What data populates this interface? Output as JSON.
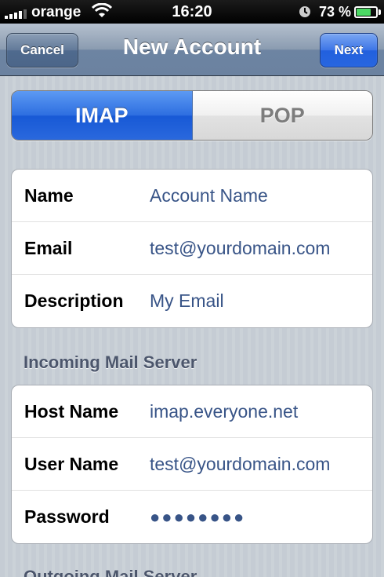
{
  "status_bar": {
    "carrier": "orange",
    "time": "16:20",
    "battery_percent": "73 %",
    "battery_level": 0.73,
    "signal_icon": "signal-bars-icon",
    "wifi_icon": "wifi-icon",
    "alarm_icon": "alarm-clock-icon",
    "battery_icon": "battery-icon"
  },
  "nav": {
    "cancel_label": "Cancel",
    "title": "New Account",
    "next_label": "Next"
  },
  "segmented": {
    "options": [
      "IMAP",
      "POP"
    ],
    "selected": "IMAP"
  },
  "account": {
    "name_label": "Name",
    "name_value": "Account Name",
    "email_label": "Email",
    "email_value": "test@yourdomain.com",
    "description_label": "Description",
    "description_value": "My Email"
  },
  "incoming": {
    "header": "Incoming Mail Server",
    "host_label": "Host Name",
    "host_value": "imap.everyone.net",
    "user_label": "User Name",
    "user_value": "test@yourdomain.com",
    "password_label": "Password",
    "password_value": "●●●●●●●●"
  },
  "outgoing": {
    "header": "Outgoing Mail Server"
  },
  "colors": {
    "accent_blue": "#2a68dd",
    "value_text": "#385487",
    "battery_green": "#4cd964"
  }
}
